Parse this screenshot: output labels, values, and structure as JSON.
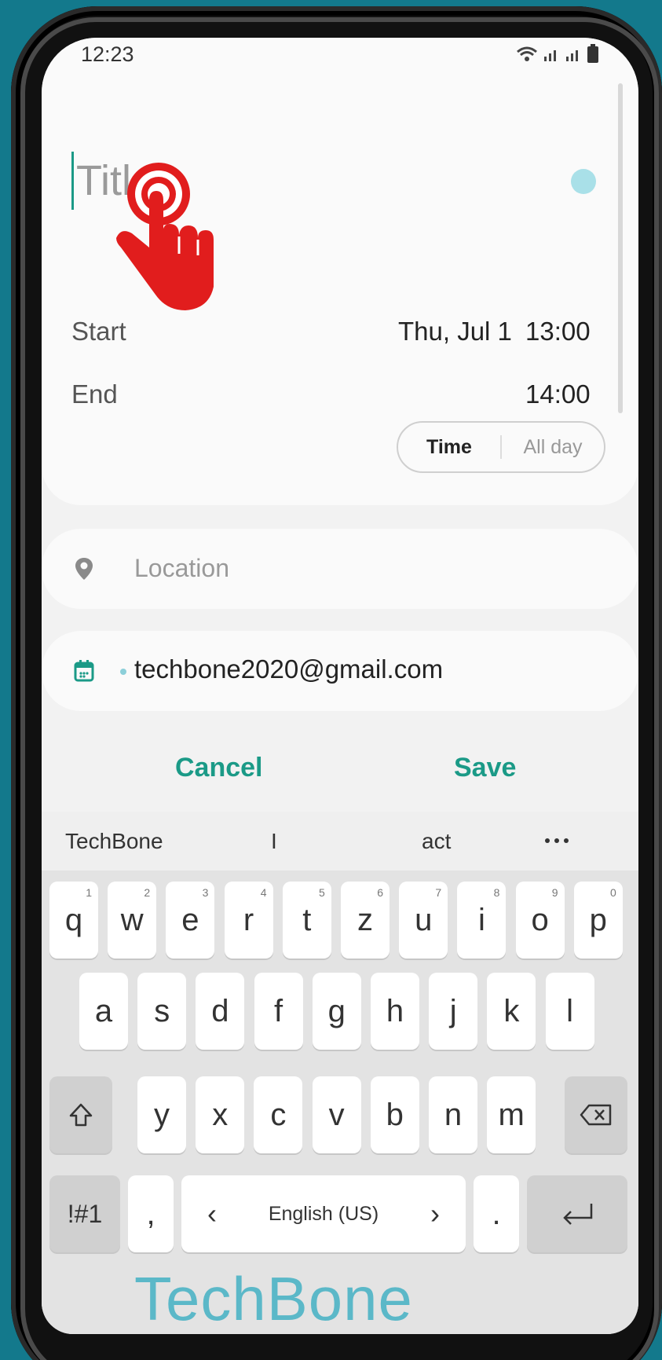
{
  "status_bar": {
    "time": "12:23"
  },
  "event": {
    "title_placeholder": "Title",
    "start_label": "Start",
    "start_date": "Thu, Jul 1",
    "start_time": "13:00",
    "end_label": "End",
    "end_time": "14:00",
    "time_option": "Time",
    "allday_option": "All day"
  },
  "location": {
    "placeholder": "Location"
  },
  "calendar": {
    "account": "techbone2020@gmail.com"
  },
  "actions": {
    "cancel": "Cancel",
    "save": "Save"
  },
  "keyboard": {
    "suggestions": [
      "TechBone",
      "I",
      "act"
    ],
    "more_icon": "more-horiz-icon",
    "row1": [
      {
        "k": "q",
        "h": "1"
      },
      {
        "k": "w",
        "h": "2"
      },
      {
        "k": "e",
        "h": "3"
      },
      {
        "k": "r",
        "h": "4"
      },
      {
        "k": "t",
        "h": "5"
      },
      {
        "k": "z",
        "h": "6"
      },
      {
        "k": "u",
        "h": "7"
      },
      {
        "k": "i",
        "h": "8"
      },
      {
        "k": "o",
        "h": "9"
      },
      {
        "k": "p",
        "h": "0"
      }
    ],
    "row2": [
      "a",
      "s",
      "d",
      "f",
      "g",
      "h",
      "j",
      "k",
      "l"
    ],
    "row3": [
      "y",
      "x",
      "c",
      "v",
      "b",
      "n",
      "m"
    ],
    "symbols_key": "!#1",
    "comma_key": ",",
    "period_key": ".",
    "language": "English (US)",
    "lang_prev": "‹",
    "lang_next": "›"
  },
  "watermark": "TechBone",
  "colors": {
    "accent": "#1b9a87",
    "event_color": "#a9e0e8",
    "cursor_hand": "#e11d1d"
  }
}
